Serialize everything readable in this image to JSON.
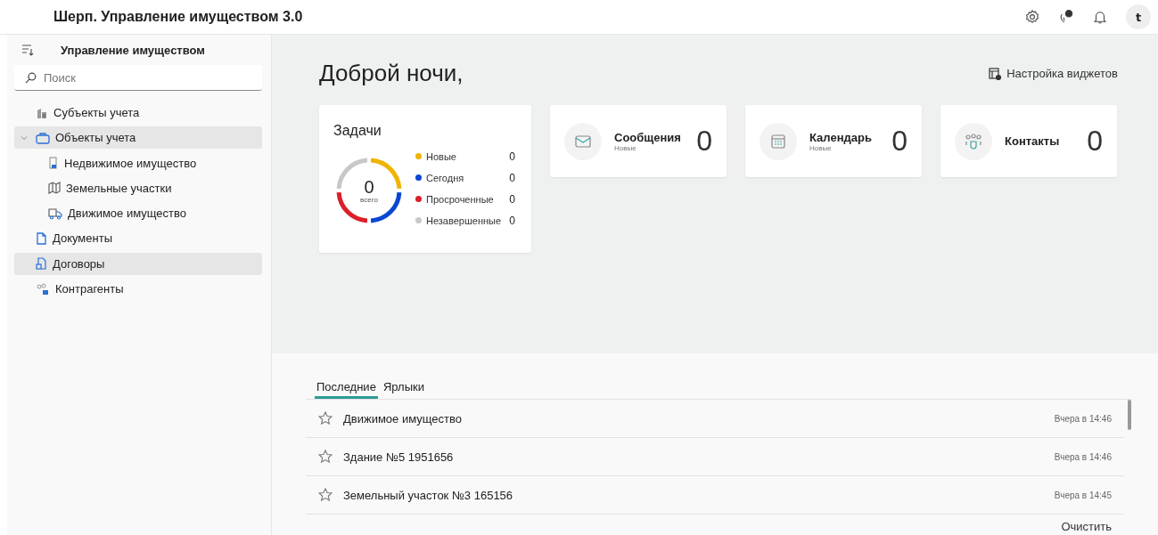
{
  "header": {
    "title": "Шерп. Управление имуществом 3.0",
    "avatar": "t"
  },
  "sidebar": {
    "title": "Управление имуществом",
    "search": {
      "placeholder": "Поиск"
    },
    "items": [
      {
        "label": "Субъекты учета",
        "selected": false
      },
      {
        "label": "Объекты учета",
        "selected": true,
        "expanded": true,
        "children": [
          {
            "label": "Недвижимое имущество",
            "selected": false
          },
          {
            "label": "Земельные участки",
            "selected": false
          },
          {
            "label": "Движимое имущество",
            "selected": false
          }
        ]
      },
      {
        "label": "Документы",
        "selected": false
      },
      {
        "label": "Договоры",
        "selected": true
      },
      {
        "label": "Контрагенты",
        "selected": false
      }
    ]
  },
  "greeting": "Доброй ночи,",
  "widget_settings": "Настройка виджетов",
  "tasks": {
    "title": "Задачи",
    "total": "0",
    "total_label": "всего",
    "legend": [
      {
        "label": "Новые",
        "value": "0",
        "color": "#f0b400"
      },
      {
        "label": "Сегодня",
        "value": "0",
        "color": "#0a47d1"
      },
      {
        "label": "Просроченные",
        "value": "0",
        "color": "#dc1f2b"
      },
      {
        "label": "Незавершенные",
        "value": "0",
        "color": "#c8c8c8"
      }
    ]
  },
  "widgets": [
    {
      "title": "Сообщения",
      "subtitle": "Новые",
      "count": "0"
    },
    {
      "title": "Календарь",
      "subtitle": "Новые",
      "count": "0"
    },
    {
      "title": "Контакты",
      "count": "0"
    }
  ],
  "recent": {
    "tabs": [
      {
        "label": "Последние",
        "selected": true
      },
      {
        "label": "Ярлыки",
        "selected": false
      }
    ],
    "rows": [
      {
        "name": "Движимое имущество",
        "time": "Вчера в 14:46"
      },
      {
        "name": "Здание №5 1951656",
        "time": "Вчера в 14:46"
      },
      {
        "name": "Земельный участок №3 165156",
        "time": "Вчера в 14:45"
      }
    ],
    "clear": "Очистить"
  }
}
